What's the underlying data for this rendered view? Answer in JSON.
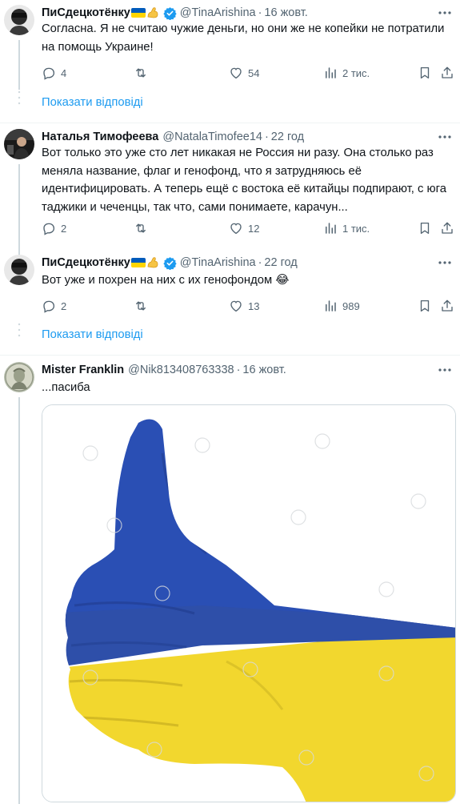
{
  "tweets": [
    {
      "name": "ПиСдецкотёнку",
      "handle": "@TinaArishina",
      "time": "16 жовт.",
      "text": "Согласна. Я не считаю чужие деньги, но они же не копейки не потратили на помощь Украине!",
      "replies": "4",
      "retweets": "",
      "likes": "54",
      "views": "2 тис.",
      "show_replies": "Показати відповіді"
    },
    {
      "name": "Наталья Тимофеева",
      "handle": "@NatalaTimofee14",
      "time": "22 год",
      "text": "Вот только это уже сто лет никакая не Россия ни разу. Она столько раз меняла название, флаг и генофонд, что я затрудняюсь её идентифицировать. А теперь ещё с востока её китайцы подпирают, с юга таджики и чеченцы, так что, сами понимаете, карачун...",
      "replies": "2",
      "retweets": "",
      "likes": "12",
      "views": "1 тис."
    },
    {
      "name": "ПиСдецкотёнку",
      "handle": "@TinaArishina",
      "time": "22 год",
      "text": "Вот уже и похрен на них с их генофондом 😂",
      "replies": "2",
      "retweets": "",
      "likes": "13",
      "views": "989",
      "show_replies": "Показати відповіді"
    },
    {
      "name": "Mister Franklin",
      "handle": "@Nik813408763338",
      "time": "16 жовт.",
      "text": "...пасиба",
      "media": "thumbs-up-ukraine-flag-image"
    }
  ],
  "colors": {
    "link": "#1d9bf0",
    "secondary_text": "#536471",
    "verified": "#1d9bf0",
    "flag_blue": "#005bbb",
    "flag_yellow": "#ffd500",
    "hand_blue": "#2a4fb4",
    "hand_yellow": "#f2d72e"
  }
}
